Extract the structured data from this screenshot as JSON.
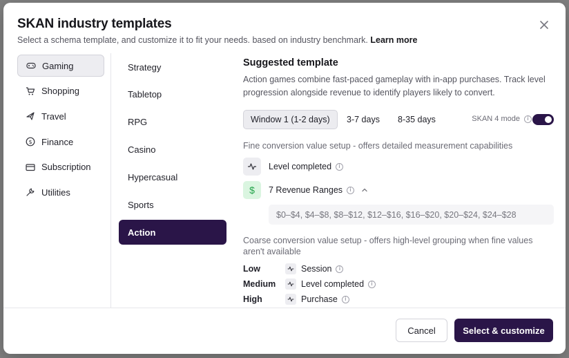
{
  "dialog": {
    "title": "SKAN industry templates",
    "subtitle": "Select a schema template, and customize it to fit your needs. based on industry benchmark.",
    "learn_more": "Learn more",
    "close_icon": "close-icon"
  },
  "industries": [
    {
      "label": "Gaming",
      "icon": "gamepad-icon",
      "active": true
    },
    {
      "label": "Shopping",
      "icon": "cart-icon",
      "active": false
    },
    {
      "label": "Travel",
      "icon": "plane-icon",
      "active": false
    },
    {
      "label": "Finance",
      "icon": "dollar-circle-icon",
      "active": false
    },
    {
      "label": "Subscription",
      "icon": "card-icon",
      "active": false
    },
    {
      "label": "Utilities",
      "icon": "wrench-icon",
      "active": false
    }
  ],
  "game_types": [
    {
      "label": "Strategy",
      "active": false
    },
    {
      "label": "Tabletop",
      "active": false
    },
    {
      "label": "RPG",
      "active": false
    },
    {
      "label": "Casino",
      "active": false
    },
    {
      "label": "Hypercasual",
      "active": false
    },
    {
      "label": "Sports",
      "active": false
    },
    {
      "label": "Action",
      "active": true
    }
  ],
  "suggested": {
    "title": "Suggested template",
    "description": "Action games combine fast-paced gameplay with in-app purchases. Track level progression alongside revenue to identify players likely to convert.",
    "windows": [
      {
        "label": "Window 1 (1-2 days)",
        "active": true
      },
      {
        "label": "3-7 days",
        "active": false
      },
      {
        "label": "8-35 days",
        "active": false
      }
    ],
    "skan_mode_label": "SKAN 4 mode",
    "skan_mode_on": true,
    "fine_label": "Fine conversion value setup - offers detailed measurement capabilities",
    "fine_items": [
      {
        "label": "Level completed",
        "icon": "activity-icon"
      },
      {
        "label": "7 Revenue Ranges",
        "icon": "dollar-icon",
        "expanded": true
      }
    ],
    "revenue_ranges": "$0–$4, $4–$8, $8–$12, $12–$16, $16–$20, $20–$24, $24–$28",
    "coarse_label": "Coarse conversion value setup - offers high-level grouping when fine values aren't available",
    "coarse_items": [
      {
        "level": "Low",
        "event": "Session"
      },
      {
        "level": "Medium",
        "event": "Level completed"
      },
      {
        "level": "High",
        "event": "Purchase"
      }
    ]
  },
  "footer": {
    "cancel_label": "Cancel",
    "primary_label": "Select & customize"
  },
  "colors": {
    "accent": "#2a1548",
    "green_badge": "#daf5e0"
  }
}
